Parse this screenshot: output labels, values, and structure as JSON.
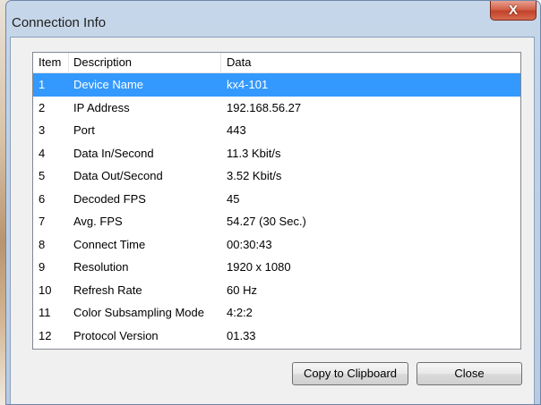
{
  "window": {
    "title": "Connection Info",
    "close_glyph": "X"
  },
  "table": {
    "columns": [
      "Item",
      "Description",
      "Data"
    ],
    "selected_index": 0,
    "rows": [
      {
        "item": "1",
        "description": "Device Name",
        "data": "kx4-101"
      },
      {
        "item": "2",
        "description": "IP Address",
        "data": "192.168.56.27"
      },
      {
        "item": "3",
        "description": "Port",
        "data": "443"
      },
      {
        "item": "4",
        "description": "Data In/Second",
        "data": "11.3 Kbit/s"
      },
      {
        "item": "5",
        "description": "Data Out/Second",
        "data": "3.52 Kbit/s"
      },
      {
        "item": "6",
        "description": "Decoded FPS",
        "data": "45"
      },
      {
        "item": "7",
        "description": "Avg. FPS",
        "data": "54.27 (30 Sec.)"
      },
      {
        "item": "8",
        "description": "Connect Time",
        "data": "00:30:43"
      },
      {
        "item": "9",
        "description": "Resolution",
        "data": "1920 x 1080"
      },
      {
        "item": "10",
        "description": "Refresh Rate",
        "data": "60 Hz"
      },
      {
        "item": "11",
        "description": "Color Subsampling Mode",
        "data": "4:2:2"
      },
      {
        "item": "12",
        "description": "Protocol Version",
        "data": "01.33"
      }
    ]
  },
  "buttons": {
    "copy_label": "Copy to Clipboard",
    "close_label": "Close"
  },
  "colors": {
    "selection": "#3399ff",
    "close_button": "#c7503a"
  }
}
